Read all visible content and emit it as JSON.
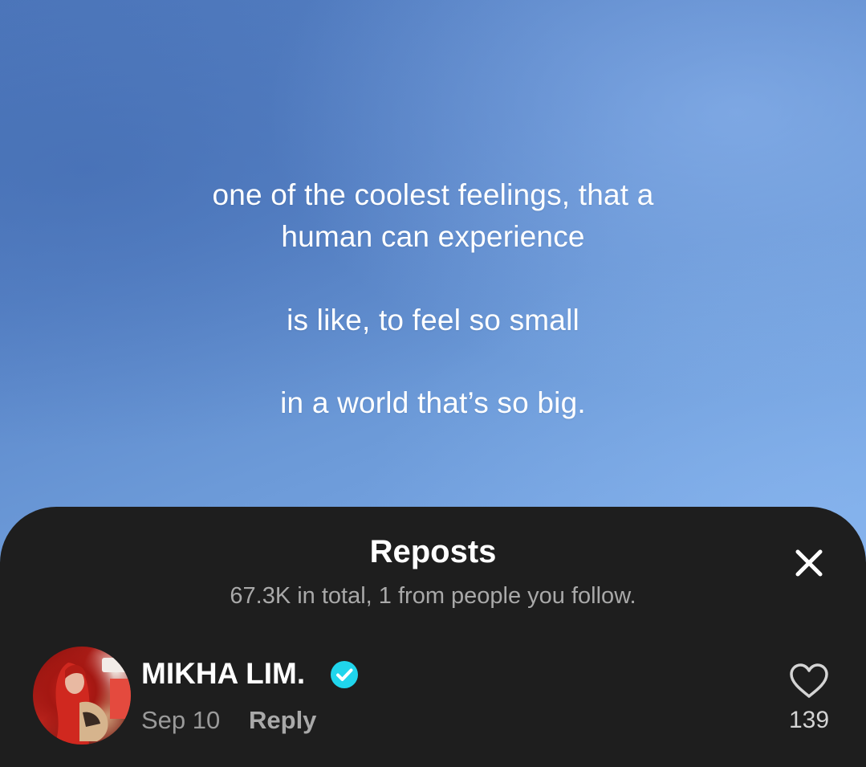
{
  "video": {
    "caption_lines": [
      "one of the coolest feelings, that a",
      "human can experience",
      "is like, to feel so small",
      "in a world that’s so big."
    ],
    "background_color": "#5f8dd0"
  },
  "sheet": {
    "title": "Reposts",
    "subtitle": "67.3K in total, 1 from people you follow.",
    "close_icon": "close-icon",
    "background_color": "#1e1e1e"
  },
  "reposts": [
    {
      "username": "MIKHA LIM.",
      "verified": true,
      "verified_color": "#20d5ec",
      "date": "Sep 10",
      "reply_label": "Reply",
      "like_icon": "heart-outline-icon",
      "like_count": "139"
    }
  ]
}
